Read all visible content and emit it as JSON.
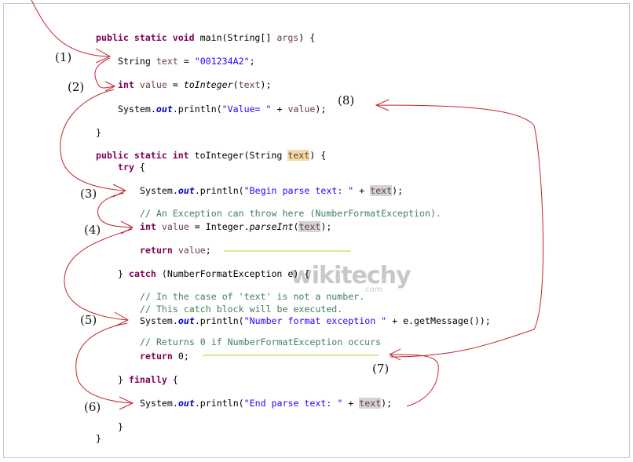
{
  "code_lines": [
    {
      "indent": 0,
      "segs": [
        [
          "public static void ",
          "kw"
        ],
        [
          "main(String[] ",
          ""
        ],
        [
          "args",
          "var"
        ],
        [
          ") {",
          ""
        ]
      ]
    },
    {
      "indent": 1,
      "segs": [
        [
          "String ",
          ""
        ],
        [
          "text",
          "var"
        ],
        [
          " = ",
          ""
        ],
        [
          "\"001234A2\"",
          "str"
        ],
        [
          ";",
          ""
        ]
      ]
    },
    {
      "indent": 1,
      "segs": [
        [
          "int ",
          "kw"
        ],
        [
          "value",
          "var"
        ],
        [
          " = ",
          ""
        ],
        [
          "toInteger",
          "it"
        ],
        [
          "(",
          ""
        ],
        [
          "text",
          "var"
        ],
        [
          ");",
          ""
        ]
      ]
    },
    {
      "indent": 1,
      "segs": [
        [
          "System.",
          ""
        ],
        [
          "out",
          "out"
        ],
        [
          ".println(",
          ""
        ],
        [
          "\"Value= \"",
          "str"
        ],
        [
          " + ",
          ""
        ],
        [
          "value",
          "var"
        ],
        [
          ");",
          ""
        ]
      ]
    },
    {
      "indent": 0,
      "segs": [
        [
          "}",
          ""
        ]
      ]
    },
    {
      "indent": 0,
      "segs": [
        [
          "public static int ",
          "kw"
        ],
        [
          "toInteger(String ",
          ""
        ],
        [
          "text",
          "var hlo"
        ],
        [
          ") {",
          ""
        ]
      ]
    },
    {
      "indent": 1,
      "segs": [
        [
          "try",
          "kw"
        ],
        [
          " {",
          ""
        ]
      ]
    },
    {
      "indent": 2,
      "segs": [
        [
          "System.",
          ""
        ],
        [
          "out",
          "out"
        ],
        [
          ".println(",
          ""
        ],
        [
          "\"Begin parse text: \"",
          "str"
        ],
        [
          " + ",
          ""
        ],
        [
          "text",
          "var hl"
        ],
        [
          ");",
          ""
        ]
      ]
    },
    {
      "indent": 2,
      "segs": [
        [
          "// An Exception can throw here (NumberFormatException).",
          "cm"
        ]
      ]
    },
    {
      "indent": 2,
      "segs": [
        [
          "int ",
          "kw"
        ],
        [
          "value",
          "var"
        ],
        [
          " = Integer.",
          ""
        ],
        [
          "parseInt",
          "it"
        ],
        [
          "(",
          ""
        ],
        [
          "text",
          "var hl"
        ],
        [
          ");",
          ""
        ]
      ]
    },
    {
      "indent": 2,
      "segs": [
        [
          "return ",
          "kw"
        ],
        [
          "value",
          "var"
        ],
        [
          ";",
          ""
        ]
      ]
    },
    {
      "indent": 1,
      "segs": [
        [
          "} ",
          ""
        ],
        [
          "catch",
          "kw"
        ],
        [
          " (NumberFormatException e) {",
          ""
        ]
      ]
    },
    {
      "indent": 2,
      "segs": [
        [
          "// In the case of 'text' is not a number.",
          "cm"
        ]
      ]
    },
    {
      "indent": 2,
      "segs": [
        [
          "// This catch block will be executed.",
          "cm"
        ]
      ]
    },
    {
      "indent": 2,
      "segs": [
        [
          "System.",
          ""
        ],
        [
          "out",
          "out"
        ],
        [
          ".println(",
          ""
        ],
        [
          "\"Number format exception \"",
          "str"
        ],
        [
          " + e.getMessage());",
          ""
        ]
      ]
    },
    {
      "indent": 2,
      "segs": [
        [
          "// Returns 0 if NumberFormatException occurs",
          "cm"
        ]
      ]
    },
    {
      "indent": 2,
      "segs": [
        [
          "return ",
          "kw"
        ],
        [
          "0;",
          ""
        ]
      ]
    },
    {
      "indent": 1,
      "segs": [
        [
          "} ",
          ""
        ],
        [
          "finally",
          "kw"
        ],
        [
          " {",
          ""
        ]
      ]
    },
    {
      "indent": 2,
      "segs": [
        [
          "System.",
          ""
        ],
        [
          "out",
          "out"
        ],
        [
          ".println(",
          ""
        ],
        [
          "\"End parse text: \"",
          "str"
        ],
        [
          " + ",
          ""
        ],
        [
          "text",
          "var hl"
        ],
        [
          ");",
          ""
        ]
      ]
    },
    {
      "indent": 1,
      "segs": [
        [
          "}",
          ""
        ]
      ]
    },
    {
      "indent": 0,
      "segs": [
        [
          "}",
          ""
        ]
      ]
    }
  ],
  "step_labels": [
    "(1)",
    "(2)",
    "(3)",
    "(4)",
    "(5)",
    "(6)",
    "(7)",
    "(8)"
  ],
  "watermark": {
    "main": "wikitechy",
    "sub": ".com"
  },
  "colors": {
    "arrow": "#c0262d",
    "highlight_line": "#d8d84a",
    "keyword": "#7f0055",
    "string": "#2a00ff",
    "comment": "#3f7f5f"
  }
}
